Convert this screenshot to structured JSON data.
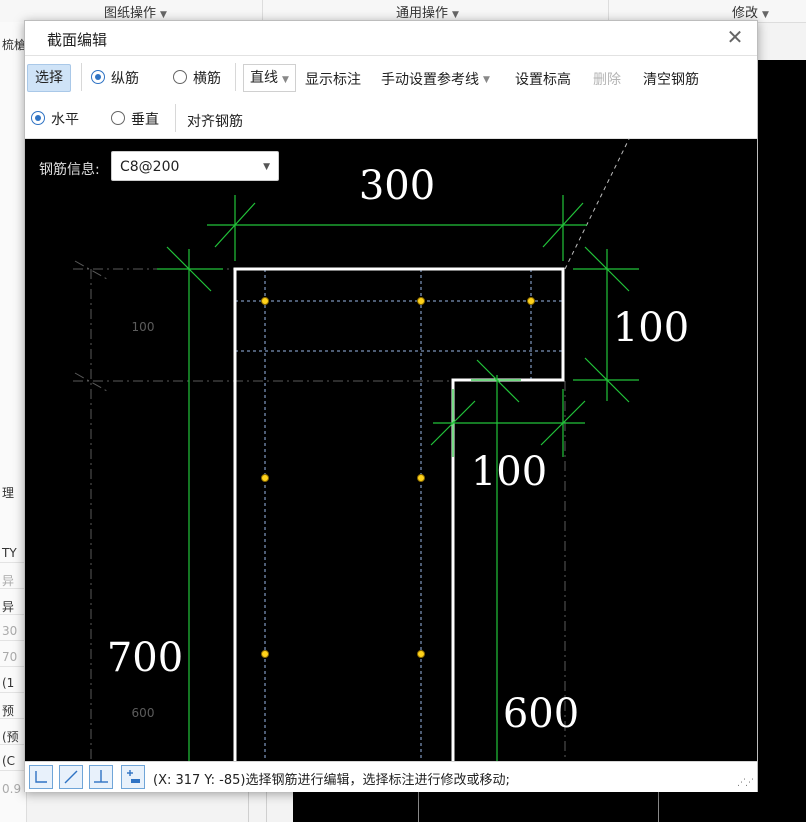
{
  "background": {
    "menus": [
      {
        "label": "图纸操作"
      },
      {
        "label": "通用操作"
      },
      {
        "label": "修改"
      }
    ],
    "left_cells": [
      {
        "text": "梳槍",
        "dim": false
      },
      {
        "text": "",
        "dim": false
      },
      {
        "text": "理",
        "dim": false
      },
      {
        "text": "TY",
        "dim": false
      },
      {
        "text": "异",
        "dim": true
      },
      {
        "text": "异",
        "dim": false
      },
      {
        "text": "30",
        "dim": true
      },
      {
        "text": "70",
        "dim": true
      },
      {
        "text": "(1",
        "dim": false
      },
      {
        "text": "预",
        "dim": false
      },
      {
        "text": "(预",
        "dim": false
      },
      {
        "text": "(C",
        "dim": false
      },
      {
        "text": "0.9",
        "dim": true
      }
    ]
  },
  "dialog": {
    "title": "截面编辑",
    "close_glyph": "✕",
    "toolbar1": {
      "select": "选择",
      "longitudinal": "纵筋",
      "transverse": "横筋",
      "line_type": "直线",
      "show_dimension": "显示标注",
      "manual_reference": "手动设置参考线",
      "set_elevation": "设置标高",
      "delete": "删除",
      "clear_rebar": "清空钢筋"
    },
    "toolbar2": {
      "horizontal": "水平",
      "vertical": "垂直",
      "align_rebar": "对齐钢筋"
    },
    "rebar_info": {
      "label": "钢筋信息:",
      "value": "C8@200"
    },
    "dimensions": {
      "top_width": "300",
      "right_flange": "100",
      "stem_width": "100",
      "total_height": "700",
      "stem_height": "600",
      "ref_small_1": "100",
      "ref_small_2": "600"
    },
    "status": {
      "coords": "(X: 317 Y: -85)选择钢筋进行编辑，选择标注进行修改或移动;"
    }
  },
  "colors": {
    "dim_green": "#22c43a",
    "rebar_yellow": "#ffd21a",
    "outline_white": "#ffffff",
    "ref_blue": "#9ab8e8",
    "accent_blue": "#2f73c4"
  }
}
